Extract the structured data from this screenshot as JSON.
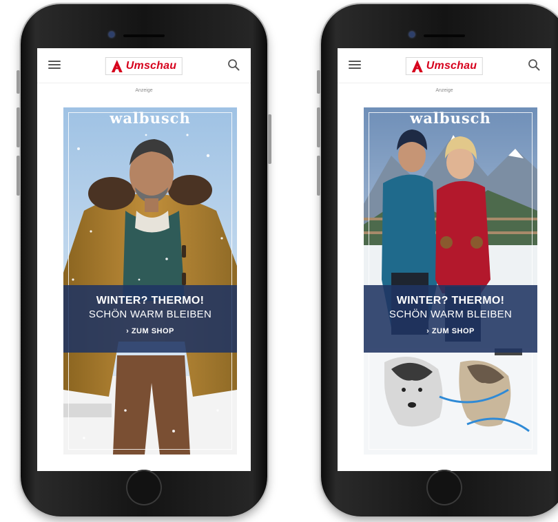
{
  "app": {
    "logo_text": "Umschau",
    "ad_label": "Anzeige"
  },
  "ads": [
    {
      "brand": "walbusch",
      "headline": "WINTER?  THERMO!",
      "subline": "SCHÖN WARM BLEIBEN",
      "cta": "ZUM SHOP",
      "cta_icon": "chevron-right-icon",
      "scene": "man in ochre parka in snowfall"
    },
    {
      "brand": "walbusch",
      "headline": "WINTER?  THERMO!",
      "subline": "SCHÖN WARM BLEIBEN",
      "cta": "ZUM SHOP",
      "cta_icon": "chevron-right-icon",
      "scene": "couple in snowy mountains, husky sled dogs"
    }
  ],
  "colors": {
    "brand_red": "#d6001c",
    "banner_blue": "#203462"
  }
}
